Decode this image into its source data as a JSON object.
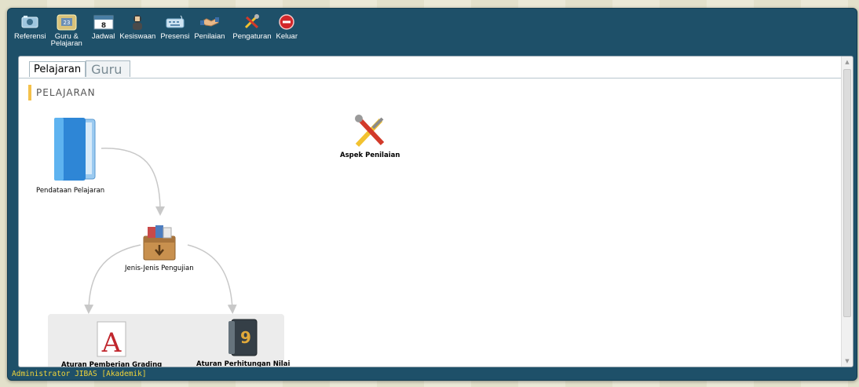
{
  "toolbar": {
    "items": [
      {
        "label": "Referensi",
        "icon": "referensi-icon"
      },
      {
        "label": "Guru &\nPelajaran",
        "icon": "guru-pelajaran-icon"
      },
      {
        "label": "Jadwal",
        "icon": "calendar-icon"
      },
      {
        "label": "Kesiswaan",
        "icon": "student-icon"
      },
      {
        "label": "Presensi",
        "icon": "keyboard-icon"
      },
      {
        "label": "Penilaian",
        "icon": "handshake-icon"
      },
      {
        "label": "Pengaturan",
        "icon": "tools-icon"
      },
      {
        "label": "Keluar",
        "icon": "exit-icon"
      }
    ]
  },
  "tabs": {
    "active": "Pelajaran",
    "inactive": "Guru"
  },
  "section": {
    "title": "PELAJARAN"
  },
  "nodes": {
    "pendataan": "Pendataan Pelajaran",
    "jenis": "Jenis-Jenis Pengujian",
    "grading": "Aturan Pemberian Grading",
    "perhitungan": "Aturan Perhitungan Nilai",
    "aspek": "Aspek Penilaian"
  },
  "status": {
    "text": "Administrator JIBAS [Akademik]"
  },
  "colors": {
    "frame": "#1e5069",
    "status_text": "#f0d43a",
    "section_accent": "#f4c14b"
  }
}
